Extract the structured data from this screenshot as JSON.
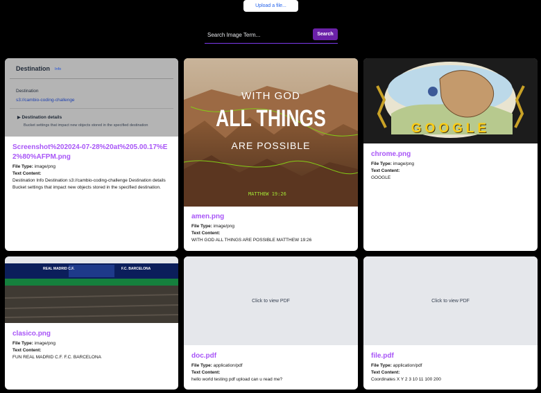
{
  "header": {
    "upload_label": "Upload a file...",
    "search_placeholder": "Search Image Term...",
    "search_button": "Search"
  },
  "labels": {
    "file_type": "File Type:",
    "text_content": "Text Content:"
  },
  "cards": [
    {
      "name": "Screenshot%202024-07-28%20at%205.00.17%E2%80%AFPM.png",
      "file_type": "image/png",
      "text": "Destination Info Destination s3://cambio-coding-challenge Destination details Bucket settings that impact new objects stored in the specified destination.",
      "preview": {
        "title": "Destination",
        "info": "Info",
        "dest_label": "Destination",
        "dest_value": "s3://cambio-coding-challenge",
        "details": "Destination details",
        "details_sub": "Bucket settings that impact new objects stored in the specified destination"
      }
    },
    {
      "name": "amen.png",
      "file_type": "image/png",
      "text": "WITH GOD ALL THINGS ARE POSSIBLE MATTHEW 19:26",
      "preview": {
        "line1": "WITH GOD",
        "line2": "ALL THINGS",
        "line3": "ARE POSSIBLE",
        "verse": "MATTHEW 19:26"
      }
    },
    {
      "name": "chrome.png",
      "file_type": "image/png",
      "text": "GOOGLE",
      "preview": {
        "logo": "GOOGLE"
      }
    },
    {
      "name": "clasico.png",
      "file_type": "image/png",
      "text": "FUN REAL MADRID C.F. F.C. BARCELONA",
      "preview": {
        "left_team": "REAL MADRID C.F.",
        "right_team": "F.C. BARCELONA"
      }
    },
    {
      "name": "doc.pdf",
      "file_type": "application/pdf",
      "text": "hello world testing pdf upload can u read me?",
      "preview": {
        "placeholder": "Click to view PDF"
      }
    },
    {
      "name": "file.pdf",
      "file_type": "application/pdf",
      "text": "Coordinates X Y 2 3 10 11 100 200",
      "preview": {
        "placeholder": "Click to view PDF"
      }
    }
  ]
}
